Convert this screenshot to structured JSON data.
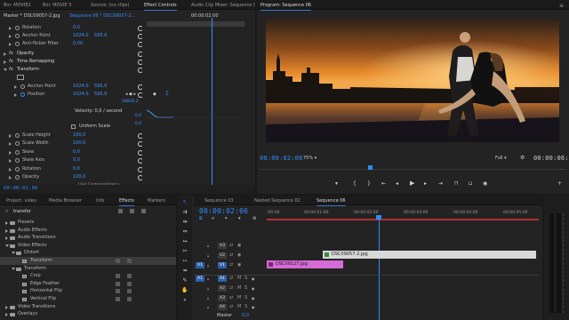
{
  "source_panel": {
    "tabs": [
      "Bin: MOVIE2",
      "Bin: MOVIE 3",
      "Source: (no clips)",
      "Effect Controls",
      "Audio Clip Mixer: Sequence 06"
    ],
    "active_tab": "Effect Controls",
    "master_label": "Master * DSC09057-2.jpg",
    "sequence_label": "Sequence 06 * DSC09057-2...",
    "mini_timecode": "00:00:02:00",
    "properties": [
      {
        "name": "Rotation",
        "value": "0,0",
        "indent": 1
      },
      {
        "name": "Anchor Point",
        "value": "1024,0",
        "value2": "595,0",
        "indent": 1
      },
      {
        "name": "Anti-flicker Filter",
        "value": "0,00",
        "indent": 1
      },
      {
        "name": "Opacity",
        "value": "",
        "indent": 0
      },
      {
        "name": "Time Remapping",
        "value": "",
        "indent": 0
      },
      {
        "name": "Transform",
        "value": "",
        "indent": 0
      },
      {
        "name": "Anchor Point",
        "value": "1024,0",
        "value2": "595,0",
        "indent": 2
      },
      {
        "name": "Position",
        "value": "1024,0",
        "value2": "595,0",
        "indent": 2
      }
    ],
    "graph_value_top": "36836,2",
    "graph_value_mid": "0,0",
    "graph_value_bot": "0,0",
    "velocity_label": "Velocity: 0,0 / second",
    "uniform_scale_label": "Uniform Scale",
    "lower_properties": [
      {
        "name": "Scale Height",
        "value": "100,0"
      },
      {
        "name": "Scale Width",
        "value": "100,0"
      },
      {
        "name": "Skew",
        "value": "0,0"
      },
      {
        "name": "Skew Axis",
        "value": "0,0"
      },
      {
        "name": "Rotation",
        "value": "0,0"
      },
      {
        "name": "Opacity",
        "value": "100,0"
      }
    ],
    "cut_label": "Use Composition's...",
    "bottom_timecode": "00:00:02:06"
  },
  "program_monitor": {
    "title": "Program: Sequence 06",
    "timecode_left": "00:00:02:06",
    "zoom": "75%",
    "quality": "Full",
    "timecode_right": "00:00:06:03",
    "colors": {
      "sky_top": "#2a2018",
      "sunset": "#e88a2a",
      "water": "#1c1a22"
    }
  },
  "project_panel": {
    "tabs": [
      "Project: video",
      "Media Browser",
      "Info",
      "Effects",
      "Markers"
    ],
    "active_tab": "Effects",
    "search_value": "transfor",
    "tree": [
      {
        "label": "Presets",
        "indent": 0,
        "kind": "folder",
        "open": false
      },
      {
        "label": "Audio Effects",
        "indent": 0,
        "kind": "folder",
        "open": false
      },
      {
        "label": "Audio Transitions",
        "indent": 0,
        "kind": "folder",
        "open": false
      },
      {
        "label": "Video Effects",
        "indent": 0,
        "kind": "folder",
        "open": true
      },
      {
        "label": "Distort",
        "indent": 1,
        "kind": "folder",
        "open": true
      },
      {
        "label": "Transform",
        "indent": 2,
        "kind": "effect",
        "selected": true
      },
      {
        "label": "Transform",
        "indent": 1,
        "kind": "folder",
        "open": true
      },
      {
        "label": "Crop",
        "indent": 2,
        "kind": "effect"
      },
      {
        "label": "Edge Feather",
        "indent": 2,
        "kind": "effect"
      },
      {
        "label": "Horizontal Flip",
        "indent": 2,
        "kind": "effect"
      },
      {
        "label": "Vertical Flip",
        "indent": 2,
        "kind": "effect"
      },
      {
        "label": "Video Transitions",
        "indent": 0,
        "kind": "folder",
        "open": false
      },
      {
        "label": "Overlays",
        "indent": 0,
        "kind": "folder",
        "open": false
      }
    ]
  },
  "timeline": {
    "tabs": [
      "Sequence 03",
      "Nested Sequence 02",
      "Sequence 06"
    ],
    "active_tab": "Sequence 06",
    "timecode": "00:00:02:06",
    "ruler": [
      ":00:00",
      "00:00:01:00",
      "00:00:02:00",
      "00:00:03:00",
      "00:00:04:00",
      "00:00:05:00"
    ],
    "tracks": [
      {
        "name": "V3",
        "type": "video"
      },
      {
        "name": "V2",
        "type": "video"
      },
      {
        "name": "V1",
        "type": "video",
        "source": "V1"
      },
      {
        "name": "A1",
        "type": "audio",
        "source": "A1"
      },
      {
        "name": "A2",
        "type": "audio"
      },
      {
        "name": "A3",
        "type": "audio"
      },
      {
        "name": "A4",
        "type": "audio"
      }
    ],
    "master_label": "Master",
    "master_value": "0,0",
    "clips": [
      {
        "label": "DSC09057-2.jpg",
        "track": "V2",
        "color": "#d8d8d8"
      },
      {
        "label": "DSC09127.jpg",
        "track": "V1",
        "color": "#d66ad6"
      }
    ]
  }
}
